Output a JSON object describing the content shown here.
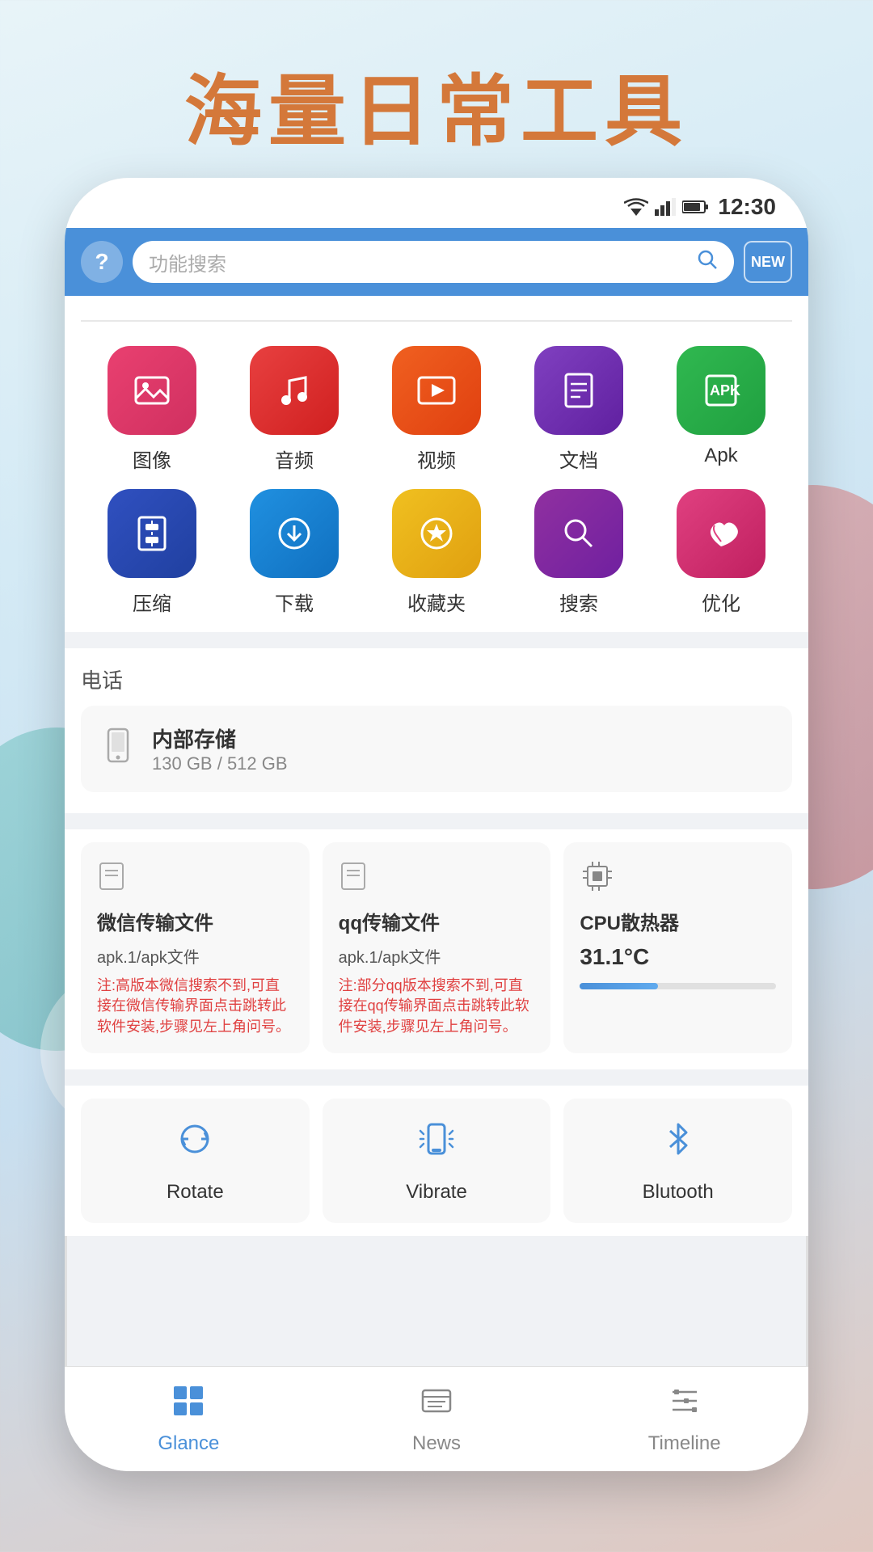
{
  "page": {
    "title": "海量日常工具",
    "background": "linear-gradient(160deg, #e8f4f8, #c8dff0, #e0c8c0)"
  },
  "status_bar": {
    "time": "12:30"
  },
  "header": {
    "help_label": "?",
    "search_placeholder": "功能搜索",
    "new_label": "NEW"
  },
  "icon_rows": [
    [
      {
        "label": "图像",
        "color": "bg-pink",
        "icon": "🖼️"
      },
      {
        "label": "音频",
        "color": "bg-red",
        "icon": "🎵"
      },
      {
        "label": "视频",
        "color": "bg-orange",
        "icon": "▶️"
      },
      {
        "label": "文档",
        "color": "bg-purple",
        "icon": "📄"
      },
      {
        "label": "Apk",
        "color": "bg-green",
        "icon": "📦"
      }
    ],
    [
      {
        "label": "压缩",
        "color": "bg-blue-dark",
        "icon": "🗜"
      },
      {
        "label": "下载",
        "color": "bg-blue",
        "icon": "⬇️"
      },
      {
        "label": "收藏夹",
        "color": "bg-yellow",
        "icon": "⭐"
      },
      {
        "label": "搜索",
        "color": "bg-purple2",
        "icon": "🔍"
      },
      {
        "label": "优化",
        "color": "bg-pink2",
        "icon": "🚀"
      }
    ]
  ],
  "phone_section": {
    "title": "电话",
    "storage": {
      "label": "内部存储",
      "used": "130 GB",
      "total": "512 GB",
      "display": "130 GB / 512 GB"
    }
  },
  "feature_cards": [
    {
      "title": "微信传输文件",
      "file": "apk.1/apk文件",
      "note": "注:高版本微信搜索不到,可直接在微信传输界面点击跳转此软件安装,步骤见左上角问号。"
    },
    {
      "title": "qq传输文件",
      "file": "apk.1/apk文件",
      "note": "注:部分qq版本搜索不到,可直接在qq传输界面点击跳转此软件安装,步骤见左上角问号。"
    },
    {
      "title": "CPU散热器",
      "temp": "31.1°C"
    }
  ],
  "util_cards": [
    {
      "label": "Rotate",
      "icon": "⟳"
    },
    {
      "label": "Vibrate",
      "icon": "📳"
    },
    {
      "label": "Blutooth",
      "icon": "⚡"
    }
  ],
  "bottom_nav": {
    "items": [
      {
        "label": "Glance",
        "active": true
      },
      {
        "label": "News",
        "active": false
      },
      {
        "label": "Timeline",
        "active": false
      }
    ]
  }
}
